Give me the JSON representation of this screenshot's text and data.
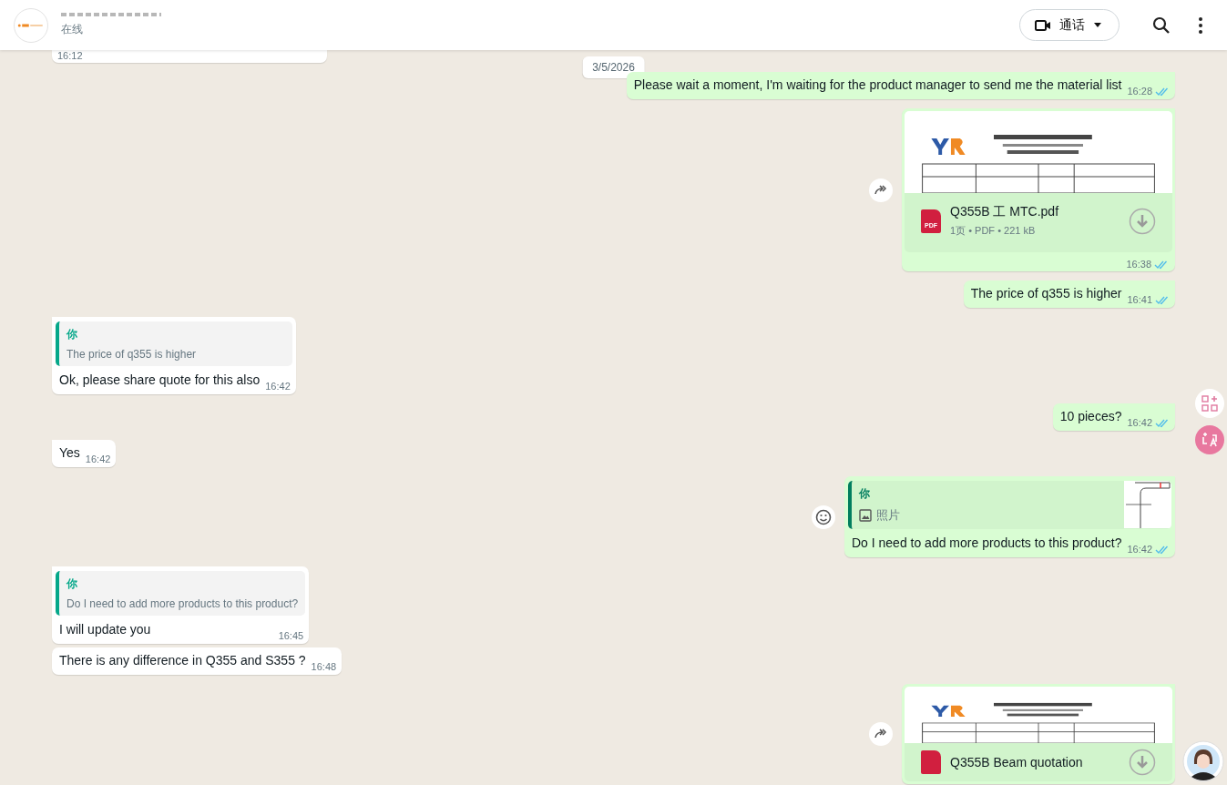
{
  "header": {
    "status": "在线",
    "call_button": "通话"
  },
  "date_chip": "3/5/2026",
  "messages": [
    {
      "kind": "text",
      "outgoing": false,
      "time": "16:12"
    },
    {
      "kind": "text",
      "outgoing": true,
      "tail": true,
      "text": "Please wait a moment, I'm waiting for the product manager to send me the material list",
      "time": "16:28",
      "read": true
    },
    {
      "kind": "document",
      "outgoing": true,
      "tail": true,
      "file_name": "Q355B 工 MTC.pdf",
      "meta": "1页 • PDF • 221 kB",
      "file_type": "PDF",
      "time": "16:38",
      "read": true
    },
    {
      "kind": "text",
      "outgoing": true,
      "tail": true,
      "text": "The price of q355 is higher",
      "time": "16:41",
      "read": true
    },
    {
      "kind": "quote",
      "outgoing": false,
      "tail": true,
      "quote_author": "你",
      "quote_text": "The price of q355 is higher",
      "text": "Ok, please share quote for this also",
      "time": "16:42"
    },
    {
      "kind": "text",
      "outgoing": true,
      "tail": true,
      "text": "10 pieces?",
      "time": "16:42",
      "read": true
    },
    {
      "kind": "text",
      "outgoing": false,
      "tail": true,
      "text": "Yes",
      "time": "16:42"
    },
    {
      "kind": "photo_quote",
      "outgoing": true,
      "tail": true,
      "quote_author": "你",
      "quote_text": "照片",
      "text": "Do I need to add more products to this product?",
      "time": "16:42",
      "read": true
    },
    {
      "kind": "quote",
      "outgoing": false,
      "tail": true,
      "quote_author": "你",
      "quote_text": "Do I need to add more products to this product?",
      "text": "I will update you",
      "time": "16:45"
    },
    {
      "kind": "text",
      "outgoing": false,
      "tail": false,
      "text": "There is any difference in Q355 and S355 ?",
      "time": "16:48"
    },
    {
      "kind": "document",
      "outgoing": true,
      "tail": true,
      "file_name": "Q355B Beam quotation"
    }
  ]
}
